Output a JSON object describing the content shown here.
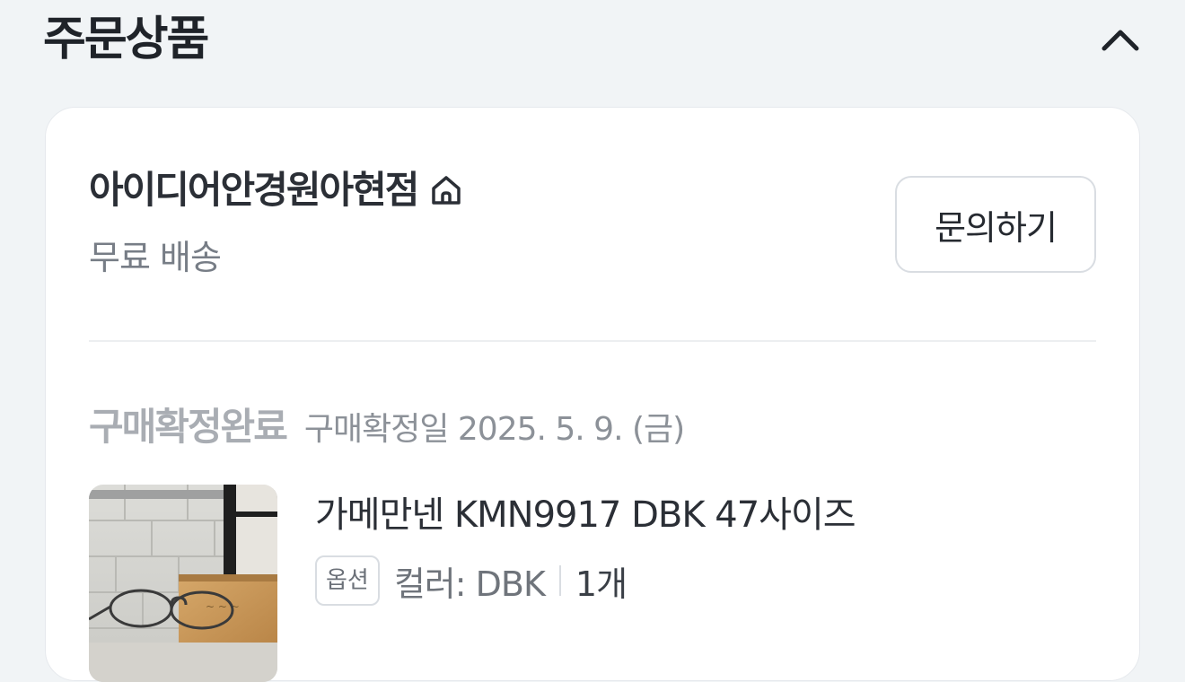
{
  "header": {
    "title": "주문상품",
    "toggle_icon": "chevron-up-icon"
  },
  "store": {
    "name": "아이디어안경원아현점",
    "icon": "home-icon",
    "shipping": "무료 배송",
    "inquiry_label": "문의하기"
  },
  "order": {
    "status": "구매확정완료",
    "confirm_date": "구매확정일 2025. 5. 9. (금)"
  },
  "product": {
    "name": "가메만넨 KMN9917 DBK 47사이즈",
    "option_badge": "옵션",
    "option_value": "컬러: DBK",
    "quantity": "1개"
  },
  "colors": {
    "background": "#f1f4f6",
    "card": "#ffffff",
    "status_text": "#a9adb3"
  }
}
